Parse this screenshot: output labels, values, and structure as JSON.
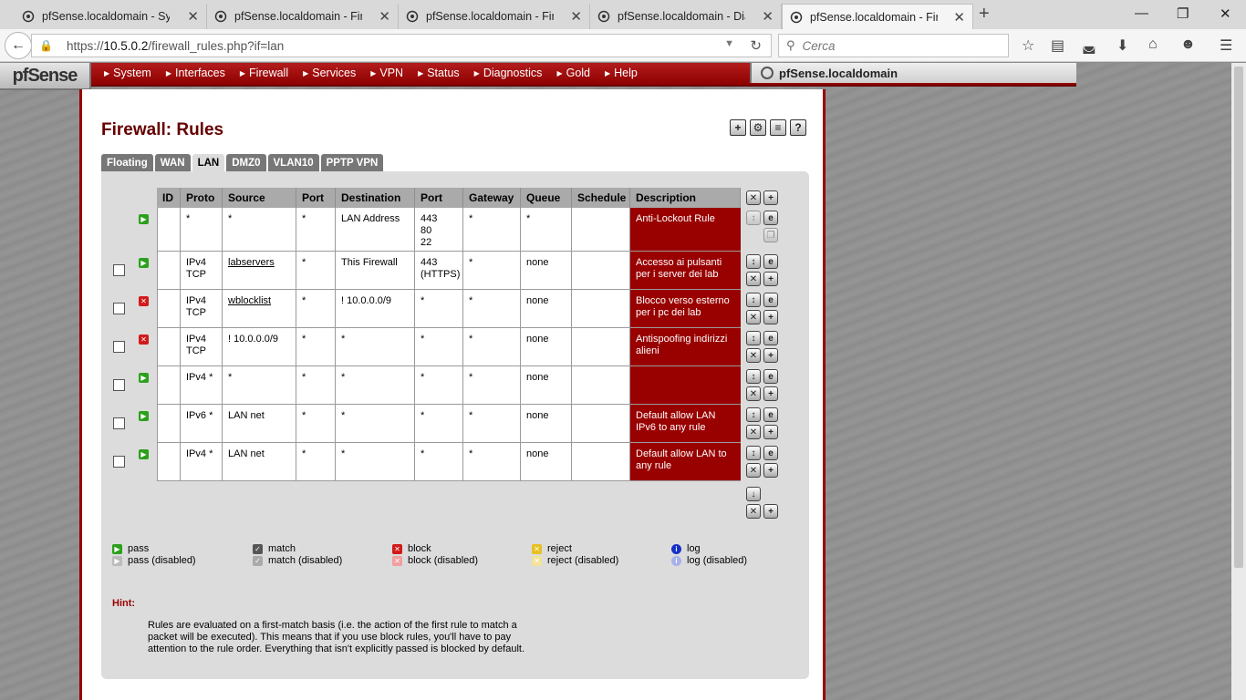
{
  "browser": {
    "tabs": [
      {
        "label": "pfSense.localdomain - Sys..."
      },
      {
        "label": "pfSense.localdomain - Fir..."
      },
      {
        "label": "pfSense.localdomain - Fir..."
      },
      {
        "label": "pfSense.localdomain - Dia..."
      },
      {
        "label": "pfSense.localdomain - Fir..."
      }
    ],
    "url_prefix": "https://",
    "url_host": "10.5.0.2",
    "url_path": "/firewall_rules.php?if=lan",
    "search_placeholder": "Cerca"
  },
  "header": {
    "logo": "pfSense",
    "menu": [
      "System",
      "Interfaces",
      "Firewall",
      "Services",
      "VPN",
      "Status",
      "Diagnostics",
      "Gold",
      "Help"
    ],
    "hostname": "pfSense.localdomain"
  },
  "page": {
    "title": "Firewall: Rules",
    "tabs": [
      "Floating",
      "WAN",
      "LAN",
      "DMZ0",
      "VLAN10",
      "PPTP VPN"
    ],
    "active_tab": "LAN"
  },
  "rules_table": {
    "columns": [
      "ID",
      "Proto",
      "Source",
      "Port",
      "Destination",
      "Port",
      "Gateway",
      "Queue",
      "Schedule",
      "Description"
    ],
    "rows": [
      {
        "checkbox": false,
        "action": "pass",
        "id": "",
        "proto": "*",
        "source": "*",
        "sport": "*",
        "dest": "LAN Address",
        "dport": "443\n80\n22",
        "gateway": "*",
        "queue": "*",
        "schedule": "",
        "desc": "Anti-Lockout Rule"
      },
      {
        "checkbox": true,
        "action": "pass",
        "id": "",
        "proto": "IPv4\nTCP",
        "source": "labservers",
        "sport": "*",
        "dest": "This Firewall",
        "dport": "443\n(HTTPS)",
        "gateway": "*",
        "queue": "none",
        "schedule": "",
        "desc": "Accesso ai pulsanti\nper i server dei lab"
      },
      {
        "checkbox": true,
        "action": "block",
        "id": "",
        "proto": "IPv4\nTCP",
        "source": "wblocklist",
        "sport": "*",
        "dest": "! 10.0.0.0/9",
        "dport": "*",
        "gateway": "*",
        "queue": "none",
        "schedule": "",
        "desc": "Blocco verso esterno\nper i pc dei lab"
      },
      {
        "checkbox": true,
        "action": "block",
        "id": "",
        "proto": "IPv4\nTCP",
        "source": "! 10.0.0.0/9",
        "sport": "*",
        "dest": "*",
        "dport": "*",
        "gateway": "*",
        "queue": "none",
        "schedule": "",
        "desc": "Antispoofing indirizzi\nalieni"
      },
      {
        "checkbox": true,
        "action": "pass",
        "id": "",
        "proto": "IPv4 *",
        "source": "*",
        "sport": "*",
        "dest": "*",
        "dport": "*",
        "gateway": "*",
        "queue": "none",
        "schedule": "",
        "desc": ""
      },
      {
        "checkbox": true,
        "action": "pass",
        "id": "",
        "proto": "IPv6 *",
        "source": "LAN net",
        "sport": "*",
        "dest": "*",
        "dport": "*",
        "gateway": "*",
        "queue": "none",
        "schedule": "",
        "desc": "Default allow LAN\nIPv6 to any rule"
      },
      {
        "checkbox": true,
        "action": "pass",
        "id": "",
        "proto": "IPv4 *",
        "source": "LAN net",
        "sport": "*",
        "dest": "*",
        "dport": "*",
        "gateway": "*",
        "queue": "none",
        "schedule": "",
        "desc": "Default allow LAN to\nany rule"
      }
    ]
  },
  "legend": [
    {
      "label": "pass",
      "icon": "pass-icon"
    },
    {
      "label": "pass (disabled)",
      "icon": "pass-disabled-icon"
    },
    {
      "label": "match",
      "icon": "match-icon"
    },
    {
      "label": "match (disabled)",
      "icon": "match-disabled-icon"
    },
    {
      "label": "block",
      "icon": "block-icon"
    },
    {
      "label": "block (disabled)",
      "icon": "block-disabled-icon"
    },
    {
      "label": "reject",
      "icon": "reject-icon"
    },
    {
      "label": "reject (disabled)",
      "icon": "reject-disabled-icon"
    },
    {
      "label": "log",
      "icon": "log-icon"
    },
    {
      "label": "log (disabled)",
      "icon": "log-disabled-icon"
    }
  ],
  "hint": {
    "title": "Hint:",
    "text": "Rules are evaluated on a first-match basis (i.e. the action of the first rule to match a packet will be executed). This means that if you use block rules, you'll have to pay attention to the rule order. Everything that isn't explicitly passed is blocked by default."
  },
  "colors": {
    "brand_red": "#990000",
    "pass_green": "#2ca01c",
    "block_red": "#d11a1a"
  }
}
